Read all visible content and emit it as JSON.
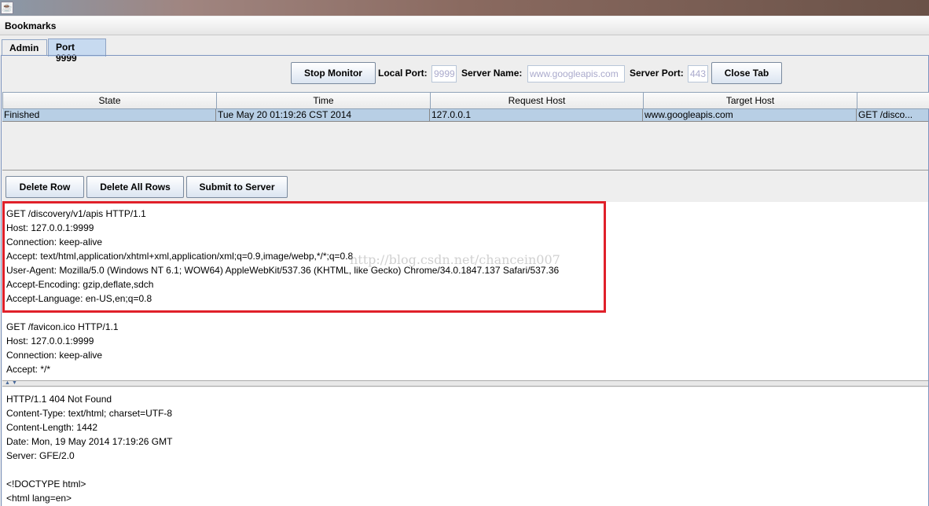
{
  "window": {
    "icon": "java-icon"
  },
  "menubar": {
    "bookmarks": "Bookmarks"
  },
  "tabs": [
    {
      "label": "Admin",
      "active": false
    },
    {
      "label": "Port 9999",
      "active": true
    }
  ],
  "toolbar": {
    "stop_monitor": "Stop Monitor",
    "local_port_label": "Local Port:",
    "local_port": "9999",
    "server_name_label": "Server Name:",
    "server_name": "www.googleapis.com",
    "server_port_label": "Server Port:",
    "server_port": "443",
    "close_tab": "Close Tab"
  },
  "table": {
    "columns": [
      "State",
      "Time",
      "Request Host",
      "Target Host",
      ""
    ],
    "rows": [
      [
        "Finished",
        "Tue May 20 01:19:26 CST 2014",
        "127.0.0.1",
        "www.googleapis.com",
        "GET /disco..."
      ]
    ]
  },
  "actions": {
    "delete_row": "Delete Row",
    "delete_all_rows": "Delete All Rows",
    "submit": "Submit to Server"
  },
  "request_text": "GET /discovery/v1/apis HTTP/1.1\nHost: 127.0.0.1:9999\nConnection: keep-alive\nAccept: text/html,application/xhtml+xml,application/xml;q=0.9,image/webp,*/*;q=0.8\nUser-Agent: Mozilla/5.0 (Windows NT 6.1; WOW64) AppleWebKit/537.36 (KHTML, like Gecko) Chrome/34.0.1847.137 Safari/537.36\nAccept-Encoding: gzip,deflate,sdch\nAccept-Language: en-US,en;q=0.8\n\nGET /favicon.ico HTTP/1.1\nHost: 127.0.0.1:9999\nConnection: keep-alive\nAccept: */*",
  "response_text": "HTTP/1.1 404 Not Found\nContent-Type: text/html; charset=UTF-8\nContent-Length: 1442\nDate: Mon, 19 May 2014 17:19:26 GMT\nServer: GFE/2.0\n\n<!DOCTYPE html>\n<html lang=en>",
  "watermark": "http://blog.csdn.net/chancein007",
  "colors": {
    "highlight": "#e0202a",
    "selected_row": "#b8cfe5"
  }
}
